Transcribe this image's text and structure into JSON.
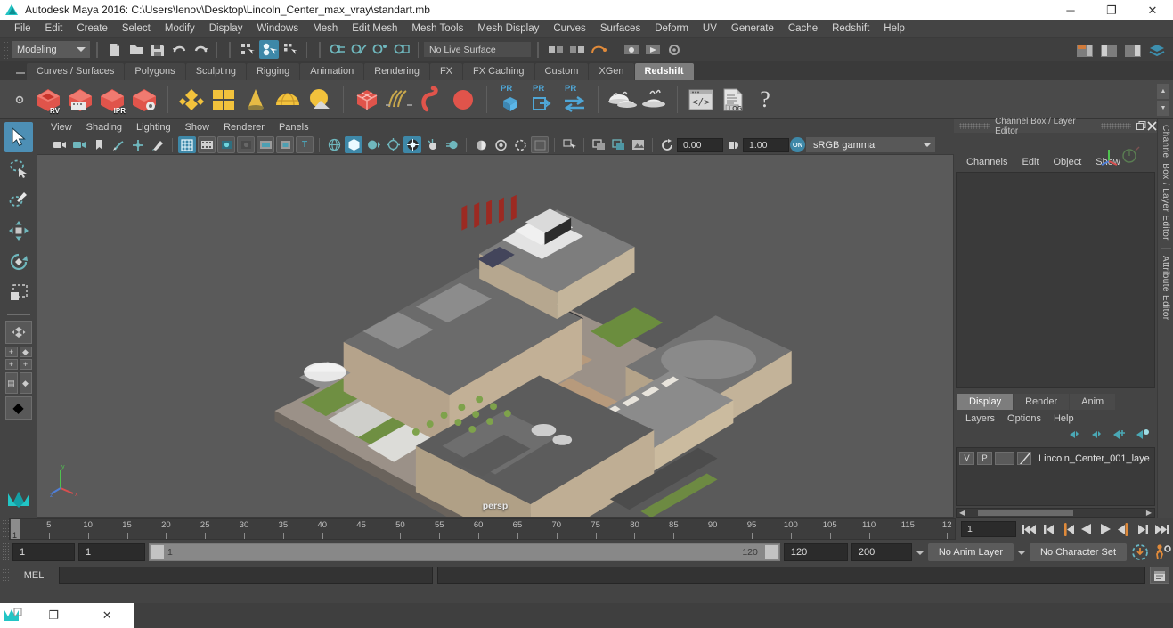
{
  "titlebar": {
    "title": "Autodesk Maya 2016: C:\\Users\\lenov\\Desktop\\Lincoln_Center_max_vray\\standart.mb",
    "logo_icon": "maya-logo-icon",
    "minimize": "─",
    "maximize": "❐",
    "close": "✕"
  },
  "menubar": {
    "items": [
      {
        "label": "File"
      },
      {
        "label": "Edit"
      },
      {
        "label": "Create"
      },
      {
        "label": "Select"
      },
      {
        "label": "Modify"
      },
      {
        "label": "Display"
      },
      {
        "label": "Windows"
      },
      {
        "label": "Mesh"
      },
      {
        "label": "Edit Mesh"
      },
      {
        "label": "Mesh Tools"
      },
      {
        "label": "Mesh Display"
      },
      {
        "label": "Curves"
      },
      {
        "label": "Surfaces"
      },
      {
        "label": "Deform"
      },
      {
        "label": "UV"
      },
      {
        "label": "Generate"
      },
      {
        "label": "Cache"
      },
      {
        "label": "Redshift"
      },
      {
        "label": "Help"
      }
    ]
  },
  "statusline": {
    "mode": "Modeling",
    "icons": [
      "new-scene-icon",
      "open-scene-icon",
      "save-scene-icon",
      "undo-icon",
      "redo-icon",
      "select-by-hierarchy-icon",
      "select-by-object-icon",
      "select-by-component-icon",
      "snap-to-grid-icon",
      "snap-to-curve-icon",
      "snap-to-point-icon"
    ],
    "no_live_surface": "No Live Surface",
    "right_icons": [
      "render-view-icon",
      "render-settings-icon",
      "hypershade-icon",
      "layers-icon"
    ]
  },
  "shelf": {
    "tabs": [
      {
        "label": "Curves / Surfaces",
        "active": false
      },
      {
        "label": "Polygons",
        "active": false
      },
      {
        "label": "Sculpting",
        "active": false
      },
      {
        "label": "Rigging",
        "active": false
      },
      {
        "label": "Animation",
        "active": false
      },
      {
        "label": "Rendering",
        "active": false
      },
      {
        "label": "FX",
        "active": false
      },
      {
        "label": "FX Caching",
        "active": false
      },
      {
        "label": "Custom",
        "active": false
      },
      {
        "label": "XGen",
        "active": false
      },
      {
        "label": "Redshift",
        "active": true
      }
    ],
    "buttons": [
      {
        "name": "redshift-render-view",
        "badge": "RV"
      },
      {
        "name": "redshift-render-sequence",
        "badge": ""
      },
      {
        "name": "redshift-ipr",
        "badge": "IPR"
      },
      {
        "name": "redshift-render-settings",
        "badge": ""
      },
      {
        "name": "redshift-material",
        "badge": ""
      },
      {
        "name": "redshift-texture",
        "badge": ""
      },
      {
        "name": "redshift-light-area",
        "badge": ""
      },
      {
        "name": "redshift-light-dome",
        "badge": ""
      },
      {
        "name": "redshift-proxy-cube",
        "badge": ""
      },
      {
        "name": "redshift-hair",
        "badge": ""
      },
      {
        "name": "redshift-volume",
        "badge": ""
      },
      {
        "name": "redshift-sphere",
        "badge": ""
      },
      {
        "name": "redshift-proxy-create",
        "badge": "PR"
      },
      {
        "name": "redshift-proxy-export",
        "badge": "PR"
      },
      {
        "name": "redshift-proxy-transfer",
        "badge": "PR"
      },
      {
        "name": "redshift-dome-light-1",
        "badge": ""
      },
      {
        "name": "redshift-dome-light-2",
        "badge": ""
      },
      {
        "name": "redshift-script-editor",
        "badge": ""
      },
      {
        "name": "redshift-log",
        "badge": "LOG"
      },
      {
        "name": "redshift-help",
        "badge": "?"
      }
    ]
  },
  "toolbox": {
    "tools": [
      {
        "name": "select-tool",
        "active": true
      },
      {
        "name": "lasso-select-tool",
        "active": false
      },
      {
        "name": "paint-select-tool",
        "active": false
      },
      {
        "name": "move-tool",
        "active": false
      },
      {
        "name": "rotate-tool",
        "active": false
      },
      {
        "name": "scale-tool",
        "active": false
      }
    ],
    "layouts": [
      "single-perspective-layout",
      "four-view-layout",
      "two-pane-layout",
      "outliner-persp-layout"
    ]
  },
  "viewport": {
    "menus": [
      {
        "label": "View"
      },
      {
        "label": "Shading"
      },
      {
        "label": "Lighting"
      },
      {
        "label": "Show"
      },
      {
        "label": "Renderer"
      },
      {
        "label": "Panels"
      }
    ],
    "exposure_value": "0.00",
    "gamma_value": "1.00",
    "color_toggle": "ON",
    "color_profile": "sRGB gamma",
    "camera_label": "persp",
    "scene": "Lincoln Center architectural model",
    "background_color": "#5a5a5a"
  },
  "channelbox": {
    "panel_title": "Channel Box / Layer Editor",
    "menus": [
      {
        "label": "Channels"
      },
      {
        "label": "Edit"
      },
      {
        "label": "Object"
      },
      {
        "label": "Show"
      }
    ],
    "side_labels": [
      "Channel Box / Layer Editor",
      "Attribute Editor"
    ],
    "undock_icon": "undock-icon",
    "close_icon": "close-icon"
  },
  "layereditor": {
    "tabs": [
      {
        "label": "Display",
        "active": true
      },
      {
        "label": "Render",
        "active": false
      },
      {
        "label": "Anim",
        "active": false
      }
    ],
    "menus": [
      {
        "label": "Layers"
      },
      {
        "label": "Options"
      },
      {
        "label": "Help"
      }
    ],
    "toolbar_icons": [
      "move-layer-up-icon",
      "move-layer-down-icon",
      "new-layer-icon",
      "new-layer-from-selected-icon"
    ],
    "layers": [
      {
        "visibility": "V",
        "playback": "P",
        "state": "",
        "name": "Lincoln_Center_001_laye"
      }
    ]
  },
  "timeslider": {
    "ticks": [
      "5",
      "10",
      "15",
      "20",
      "25",
      "30",
      "35",
      "40",
      "45",
      "50",
      "55",
      "60",
      "65",
      "70",
      "75",
      "80",
      "85",
      "90",
      "95",
      "100",
      "105",
      "110",
      "115",
      "12"
    ],
    "current_frame": "1",
    "frame_field": "1",
    "playback_buttons": [
      "go-to-start-icon",
      "step-back-keyframe-icon",
      "step-back-frame-icon",
      "play-backwards-icon",
      "play-forwards-icon",
      "step-forward-frame-icon",
      "step-forward-keyframe-icon",
      "go-to-end-icon"
    ]
  },
  "rangeslider": {
    "anim_start": "1",
    "range_start": "1",
    "bar_start_label": "1",
    "bar_end_label": "120",
    "range_end": "120",
    "anim_end": "200",
    "anim_layer": "No Anim Layer",
    "character_set": "No Character Set",
    "auto_key_icon": "auto-keyframe-icon",
    "anim_prefs_icon": "animation-preferences-icon"
  },
  "commandline": {
    "language": "MEL",
    "input_value": "",
    "output_value": "",
    "script_editor_icon": "script-editor-icon"
  },
  "taskbar": {
    "app_icon": "maya-taskbar-icon",
    "restore": "❐",
    "close": "✕"
  },
  "colors": {
    "accent_blue": "#3e88a8",
    "redshift_red": "#d9453c",
    "teal_icon": "#6fb7bd",
    "panel_bg": "#444444",
    "viewport_bg": "#5a5a5a",
    "active_tab": "#7d7d7d"
  }
}
